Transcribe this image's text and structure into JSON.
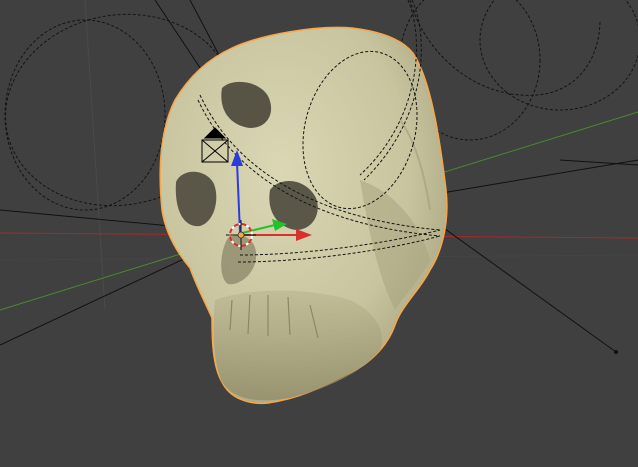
{
  "app": {
    "name": "3D Viewport",
    "editor_type": "3d-view",
    "background_color": "#404040"
  },
  "scene": {
    "selected_object": {
      "icon": "skull-mesh-icon",
      "state": "selected",
      "outline_color": "#f7a64a",
      "surface_color": "#cfcba6"
    },
    "axes": {
      "x_axis_color": "#a52a2a",
      "y_axis_color": "#4c8a2c"
    },
    "camera": {
      "icon": "camera-icon"
    },
    "transform_manipulator": {
      "icon": "transform-gizmo-icon",
      "z_arrow_color": "#2a3ddb",
      "y_arrow_color": "#22c22b",
      "x_arrow_color": "#d8302a"
    },
    "cursor_3d": {
      "icon": "3d-cursor-icon"
    },
    "origin_point": {
      "icon": "origin-dot-icon",
      "color": "#f7a64a"
    }
  }
}
